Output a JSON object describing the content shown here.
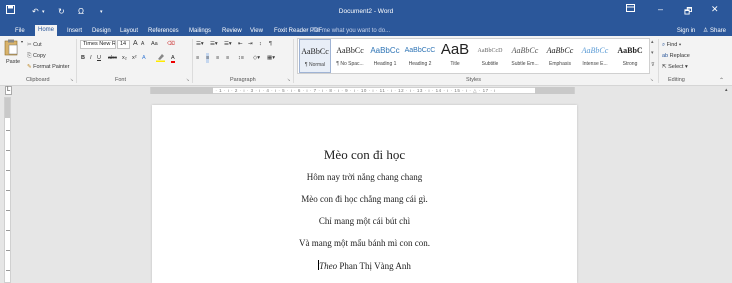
{
  "titlebar": {
    "title": "Document2 - Word",
    "save_icon": "save-icon",
    "undo_icon": "undo-icon",
    "redo_icon": "redo-icon",
    "omega_icon": "omega-icon",
    "more_icon": "customize-icon"
  },
  "window_controls": {
    "ribbon_display": "ribbon-display-icon",
    "minimize": "–",
    "restore": "🗗",
    "close": "✕"
  },
  "tabs": [
    {
      "label": "File"
    },
    {
      "label": "Home"
    },
    {
      "label": "Insert"
    },
    {
      "label": "Design"
    },
    {
      "label": "Layout"
    },
    {
      "label": "References"
    },
    {
      "label": "Mailings"
    },
    {
      "label": "Review"
    },
    {
      "label": "View"
    },
    {
      "label": "Foxit Reader PDF"
    }
  ],
  "tell_me": "Tell me what you want to do...",
  "sign_in": "Sign in",
  "share": "Share",
  "clipboard": {
    "paste": "Paste",
    "cut": "Cut",
    "copy": "Copy",
    "format_painter": "Format Painter",
    "label": "Clipboard"
  },
  "font": {
    "name": "Times New R",
    "size": "14",
    "bold": "B",
    "italic": "I",
    "underline": "U",
    "strike": "abc",
    "sub": "x₂",
    "sup": "x²",
    "grow": "A",
    "shrink": "A",
    "case": "Aa",
    "label": "Font"
  },
  "paragraph": {
    "label": "Paragraph",
    "pilcrow": "¶"
  },
  "styles": {
    "label": "Styles",
    "items": [
      {
        "sample": "AaBbCc",
        "name": "¶ Normal"
      },
      {
        "sample": "AaBbCc",
        "name": "¶ No Spac..."
      },
      {
        "sample": "AaBbCc",
        "name": "Heading 1"
      },
      {
        "sample": "AaBbCcC",
        "name": "Heading 2"
      },
      {
        "sample": "AaB",
        "name": "Title"
      },
      {
        "sample": "AaBbCcD",
        "name": "Subtitle"
      },
      {
        "sample": "AaBbCc",
        "name": "Subtle Em..."
      },
      {
        "sample": "AaBbCc",
        "name": "Emphasis"
      },
      {
        "sample": "AaBbCc",
        "name": "Intense E..."
      },
      {
        "sample": "AaBbC",
        "name": "Strong"
      }
    ]
  },
  "editing": {
    "find": "Find",
    "replace": "Replace",
    "select": "Select",
    "label": "Editing"
  },
  "ruler_text": "· 1 · ı · 2 · ı · 1 · ı · ⊥ · ı · 1 · ı · 2 · ı · 3 · ı · 4 · ı · 5 · ı · 6 · ı · 7 · ı · 8 · ı · 9 · ı · 10 · ı · 11 · ı · 12 · ı · 13 · ı · 14 · ı · 15 · ı · △ · 17 · ı",
  "document": {
    "title": "Mèo con đi học",
    "lines": [
      "Hôm nay trời nắng chang chang",
      "Mèo con đi học chẳng mang cái gì.",
      "Chỉ mang một cái bút chì",
      "Và mang một mẩu bánh mì con con."
    ],
    "attribution_prefix": "Theo",
    "attribution_author": " Phan Thị Vàng Anh"
  }
}
